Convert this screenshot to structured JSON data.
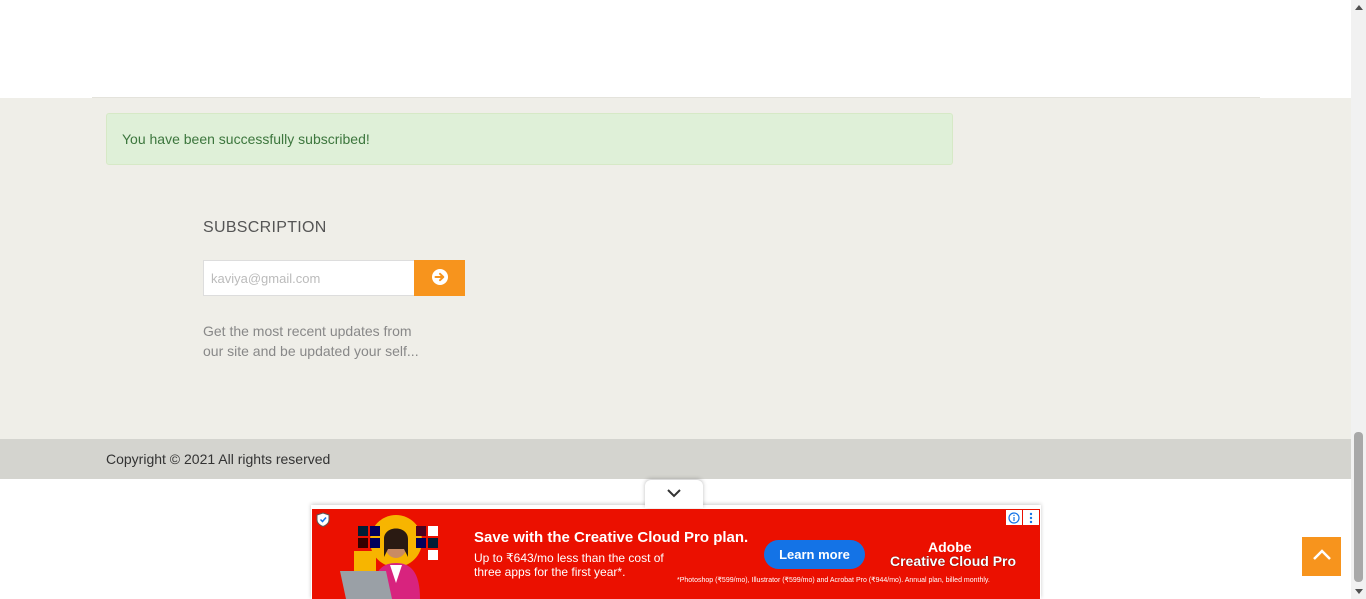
{
  "alert": {
    "message": "You have been successfully subscribed!"
  },
  "subscription": {
    "title": "SUBSCRIPTION",
    "email_value": "kaviya@gmail.com",
    "description": "Get the most recent updates from our site and be updated your self..."
  },
  "footer": {
    "copyright": "Copyright © 2021 All rights reserved"
  },
  "ad": {
    "headline": "Save with the Creative Cloud Pro plan.",
    "subline": "Up to ₹643/mo less than the cost of three apps for the first year*.",
    "cta_label": "Learn more",
    "brand_line1": "Adobe",
    "brand_line2": "Creative Cloud Pro",
    "fine_print": "*Photoshop (₹599/mo), Illustrator (₹599/mo) and Acrobat Pro (₹944/mo). Annual plan, billed monthly.",
    "background_color": "#eb1000"
  },
  "colors": {
    "accent": "#f7941d",
    "alert_bg": "#dff0d8",
    "alert_text": "#3c763d"
  }
}
